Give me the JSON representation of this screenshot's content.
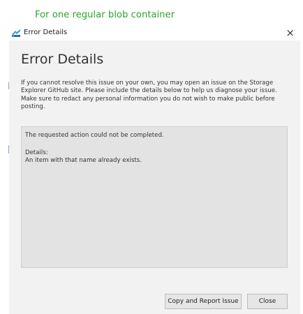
{
  "caption": "For one regular blob container",
  "window": {
    "title": "Error Details",
    "close_glyph": "×",
    "icon": "storage-explorer-icon"
  },
  "dialog": {
    "heading": "Error Details",
    "description": "If you cannot resolve this issue on your own, you may open an issue on the Storage Explorer GitHub site. Please include the details below to help us diagnose your issue. Make sure to redact any personal information you do not wish to make public before posting.",
    "details": {
      "message": "The requested action could not be completed.",
      "details_label": "Details:",
      "details_text": "An item with that name already exists."
    },
    "buttons": {
      "copy_report": "Copy and Report Issue",
      "close": "Close"
    }
  },
  "colors": {
    "caption": "#2aa12a",
    "dialog_background": "#f2f2f2",
    "details_background": "#e3e3e3"
  }
}
